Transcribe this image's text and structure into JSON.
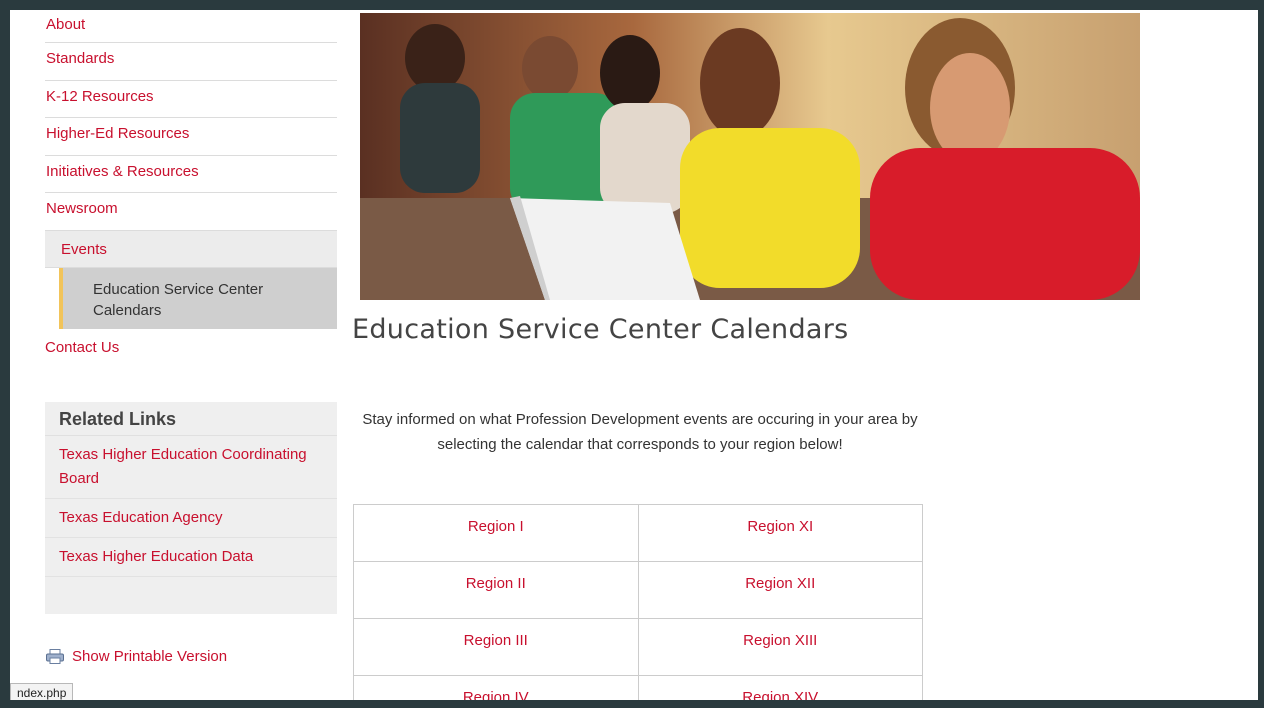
{
  "nav": {
    "items": [
      "About",
      "Standards",
      "K-12 Resources",
      "Higher-Ed Resources",
      "Initiatives & Resources",
      "Newsroom"
    ],
    "sub": "Events",
    "subsub": "Education Service Center Calendars",
    "contact": "Contact Us"
  },
  "related": {
    "title": "Related Links",
    "links": [
      "Texas Higher Education Coordinating Board",
      "Texas Education Agency",
      "Texas Higher Education Data"
    ]
  },
  "printable": {
    "label": "Show Printable Version",
    "icon": "printer-icon"
  },
  "status_bar": "ndex.php",
  "main": {
    "title": "Education Service Center Calendars",
    "intro": "Stay informed on what Profession Development events are occuring in your area by selecting the calendar that corresponds to your region below!",
    "regions": [
      [
        "Region I",
        "Region XI"
      ],
      [
        "Region II",
        "Region XII"
      ],
      [
        "Region III",
        "Region XIII"
      ],
      [
        "Region IV",
        "Region XIV"
      ]
    ]
  },
  "colors": {
    "link": "#c8102e",
    "accent": "#f2c45a"
  }
}
